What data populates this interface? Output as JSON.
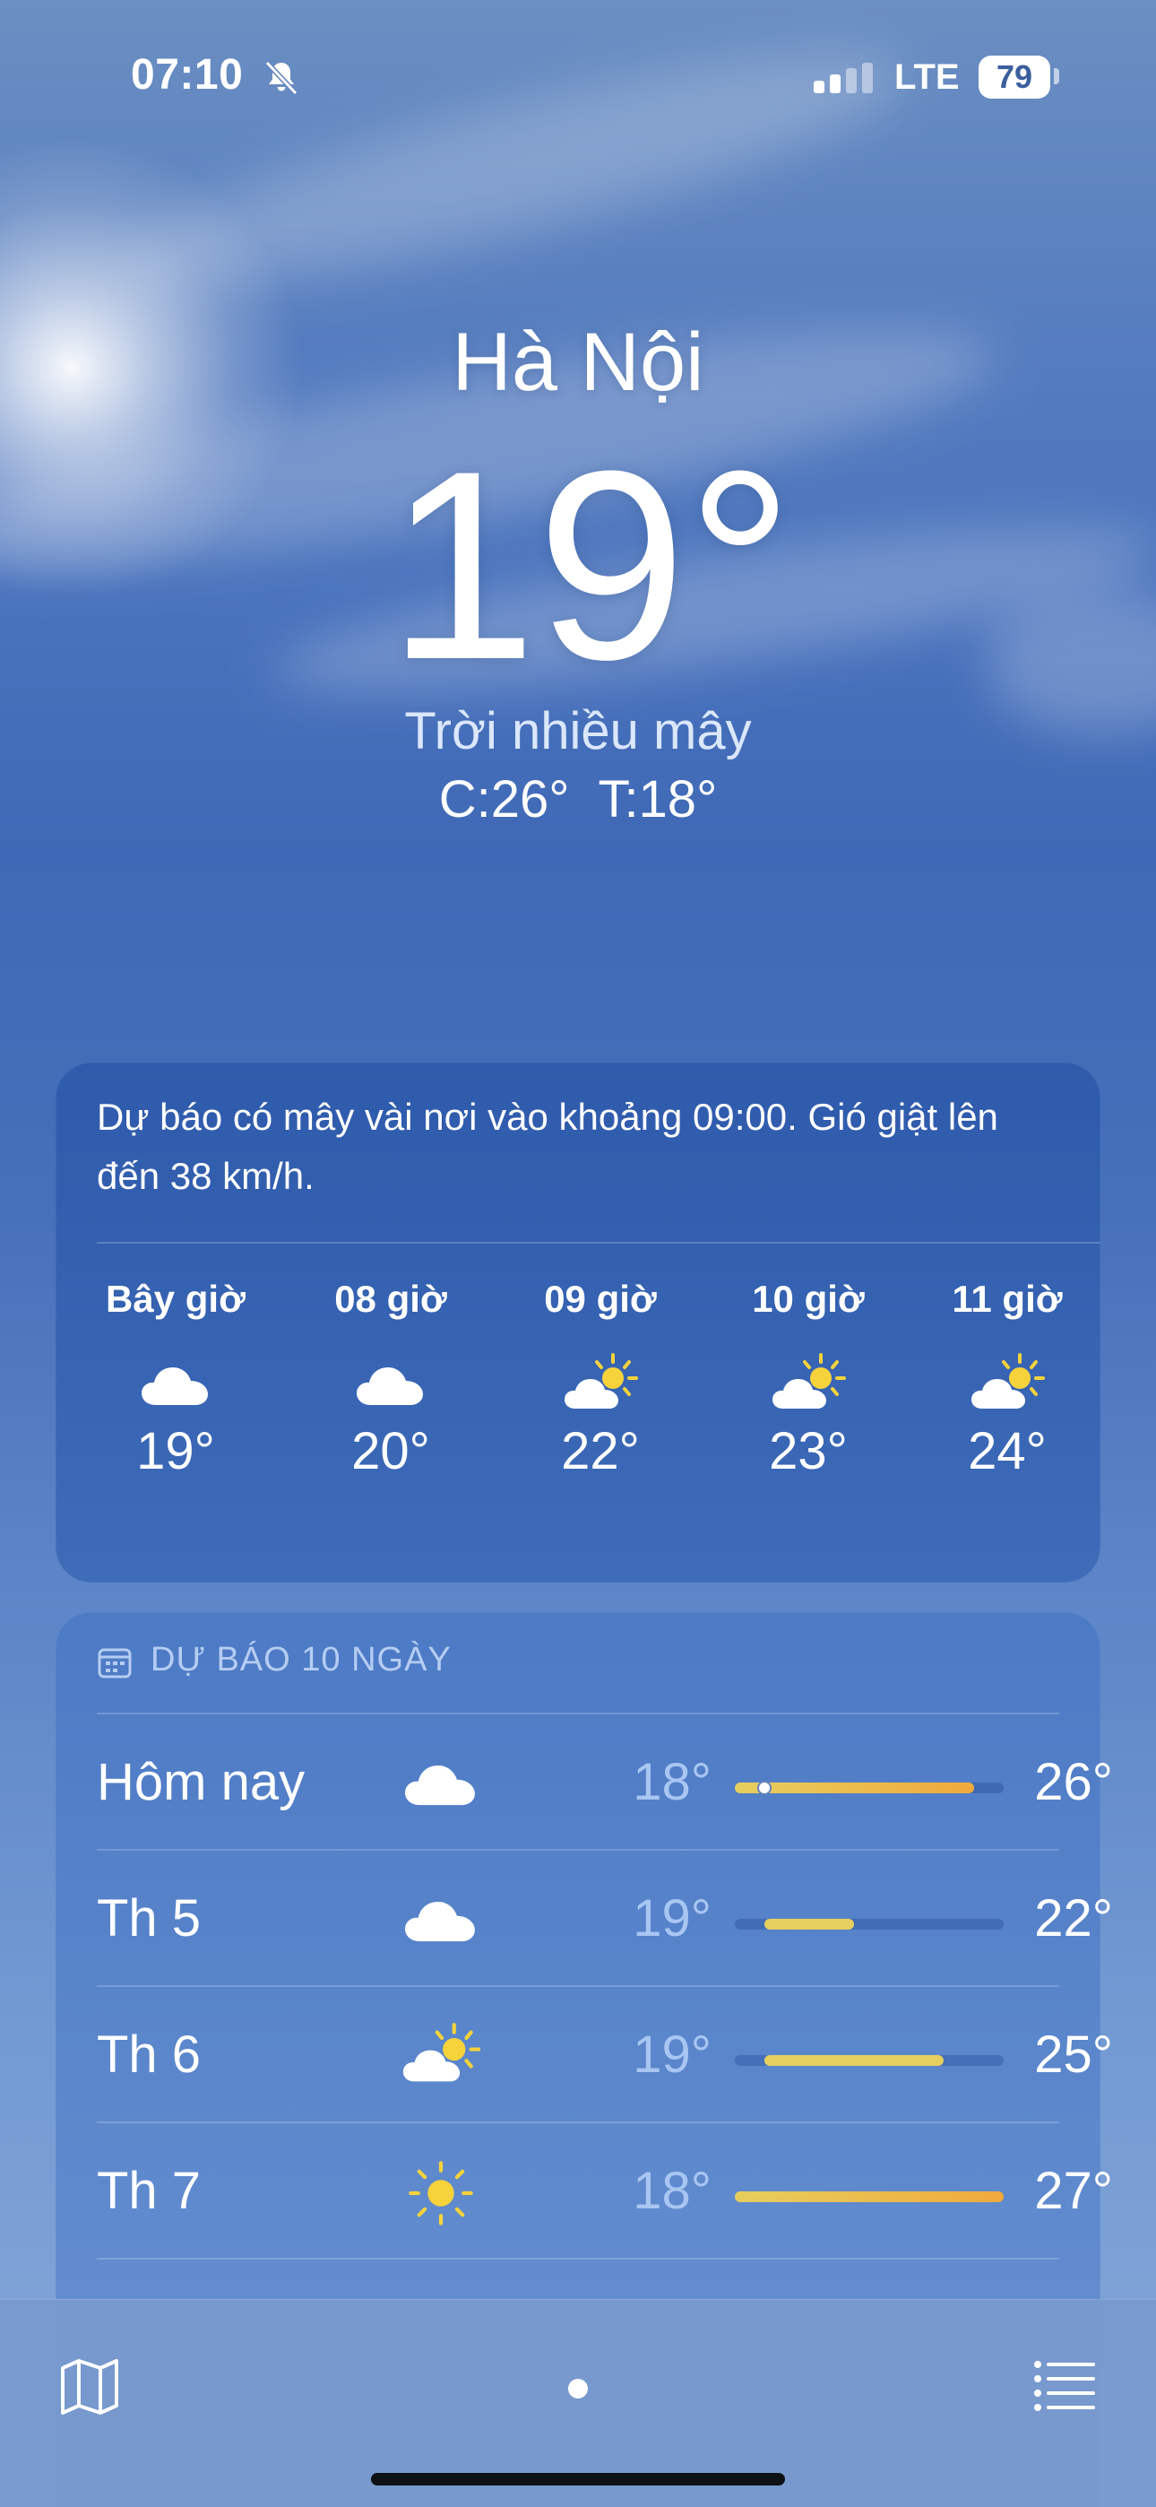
{
  "status_bar": {
    "time": "07:10",
    "network": "LTE",
    "battery": "79",
    "silent_icon": "bell-slash-icon",
    "signal_icon": "cellular-signal-icon"
  },
  "location": "Hà Nội",
  "current": {
    "temperature": "19°",
    "condition": "Trời nhiều mây",
    "high": "C:26°",
    "low": "T:18°"
  },
  "hourly": {
    "summary": "Dự báo có mây vài nơi vào khoảng 09:00. Gió giật lên đến 38 km/h.",
    "items": [
      {
        "label": "Bây giờ",
        "icon": "cloud-icon",
        "temp": "19°"
      },
      {
        "label": "08 giờ",
        "icon": "cloud-icon",
        "temp": "20°"
      },
      {
        "label": "09 giờ",
        "icon": "partly-sunny-icon",
        "temp": "22°"
      },
      {
        "label": "10 giờ",
        "icon": "partly-sunny-icon",
        "temp": "23°"
      },
      {
        "label": "11 giờ",
        "icon": "partly-sunny-icon",
        "temp": "24°"
      }
    ]
  },
  "daily": {
    "title": "DỰ BÁO 10 NGÀY",
    "range_min": 18,
    "range_max": 27,
    "days": [
      {
        "name": "Hôm nay",
        "icon": "cloud-icon",
        "low": "18°",
        "high": "26°",
        "low_value": 18,
        "high_value": 26,
        "current_value": 19
      },
      {
        "name": "Th 5",
        "icon": "cloud-icon",
        "low": "19°",
        "high": "22°",
        "low_value": 19,
        "high_value": 22
      },
      {
        "name": "Th 6",
        "icon": "partly-sunny-icon",
        "low": "19°",
        "high": "25°",
        "low_value": 19,
        "high_value": 25
      },
      {
        "name": "Th 7",
        "icon": "sun-icon",
        "low": "18°",
        "high": "27°",
        "low_value": 18,
        "high_value": 27
      }
    ]
  },
  "toolbar": {
    "map_icon": "map-icon",
    "list_icon": "list-icon"
  },
  "colors": {
    "bar_warm_start": "#e6cf5e",
    "bar_warm_end": "#f0a93c",
    "secondary_text": "#a9c6f2"
  }
}
